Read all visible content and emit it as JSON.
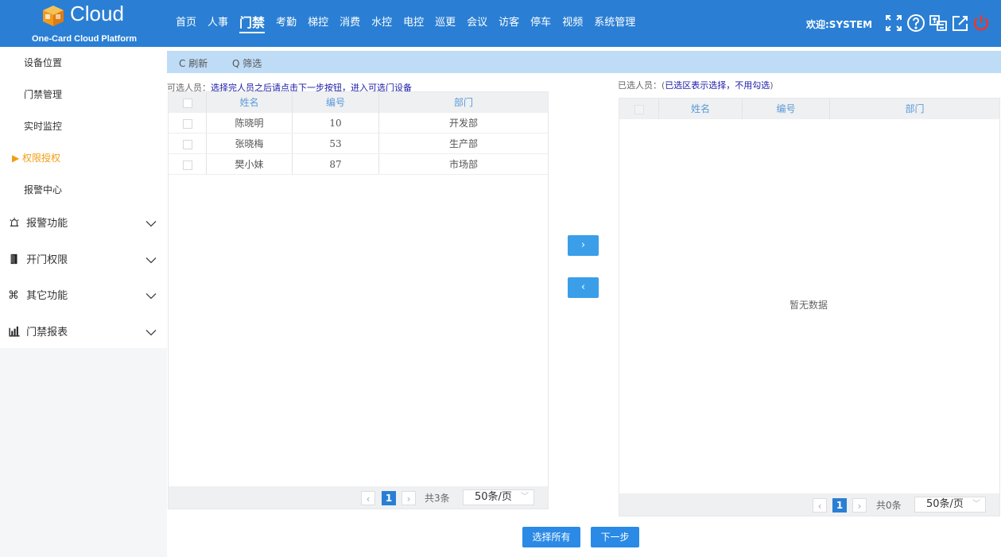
{
  "header": {
    "logo_text": "Cloud",
    "logo_sub": "One-Card Cloud Platform",
    "nav": [
      "首页",
      "人事",
      "门禁",
      "考勤",
      "梯控",
      "消费",
      "水控",
      "电控",
      "巡更",
      "会议",
      "访客",
      "停车",
      "视频",
      "系统管理"
    ],
    "active_nav": "门禁",
    "welcome": "欢迎:SYSTEM",
    "icons": [
      "fullscreen-icon",
      "help-icon",
      "language-icon",
      "edit-icon",
      "power-icon"
    ]
  },
  "sidebar": {
    "sub_items": [
      "设备位置",
      "门禁管理",
      "实时监控",
      "权限授权",
      "报警中心"
    ],
    "active_sub": "权限授权",
    "groups": [
      {
        "label": "报警功能",
        "icon": "alarm-icon"
      },
      {
        "label": "开门权限",
        "icon": "door-icon"
      },
      {
        "label": "其它功能",
        "icon": "command-icon"
      },
      {
        "label": "门禁报表",
        "icon": "bar-chart-icon"
      }
    ]
  },
  "toolbar": {
    "refresh": "C 刷新",
    "filter": "Q 筛选"
  },
  "left_panel": {
    "label": "可选人员：",
    "hint": "选择完人员之后请点击下一步按钮，进入可选门设备",
    "columns": [
      "姓名",
      "编号",
      "部门"
    ],
    "rows": [
      {
        "name": "陈晓明",
        "id": "10",
        "dept": "开发部"
      },
      {
        "name": "张晓梅",
        "id": "53",
        "dept": "生产部"
      },
      {
        "name": "樊小妹",
        "id": "87",
        "dept": "市场部"
      }
    ],
    "page": "1",
    "total": "共3条",
    "page_size": "50条/页"
  },
  "right_panel": {
    "label": "已选人员：(",
    "hint": "已选区表示选择，不用勾选",
    "label_end": ")",
    "columns": [
      "姓名",
      "编号",
      "部门"
    ],
    "empty": "暂无数据",
    "page": "1",
    "total": "共0条",
    "page_size": "50条/页"
  },
  "transfer": {
    "right": "›",
    "left": "‹"
  },
  "buttons": {
    "select_all": "选择所有",
    "next": "下一步"
  },
  "colors": {
    "header": "#2a7fd4",
    "accent": "#f39c12",
    "toolbar": "#bfdcf7"
  }
}
